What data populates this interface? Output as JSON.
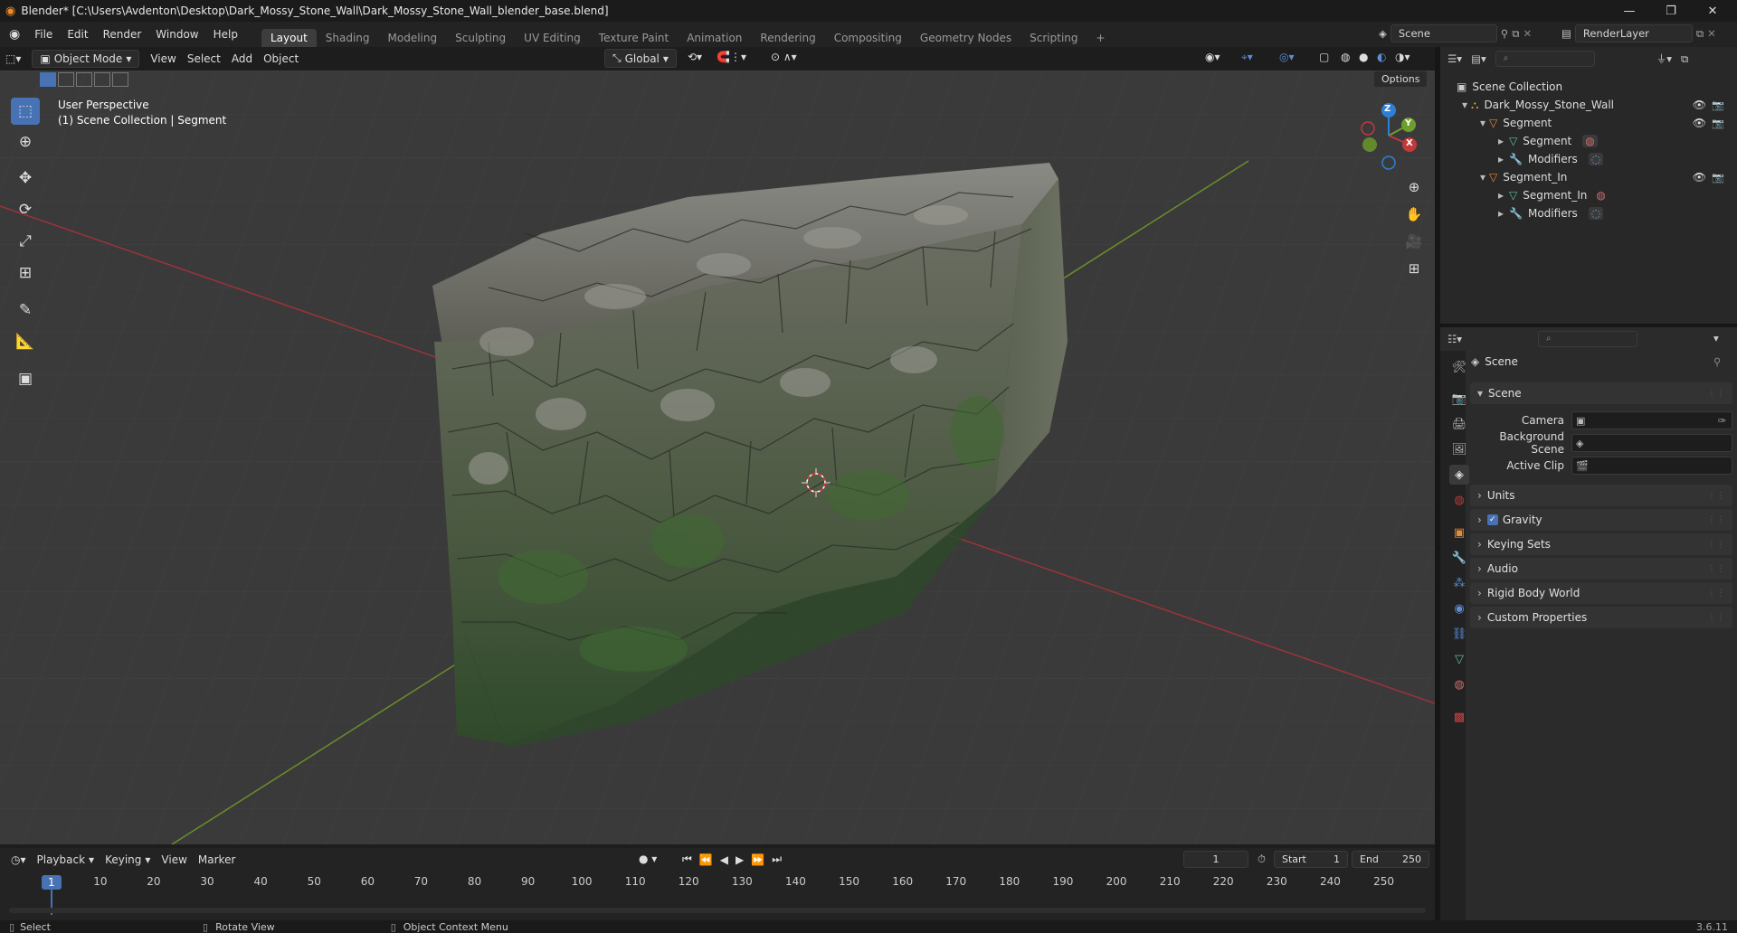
{
  "window": {
    "title": "Blender* [C:\\Users\\Avdenton\\Desktop\\Dark_Mossy_Stone_Wall\\Dark_Mossy_Stone_Wall_blender_base.blend]",
    "minimize": "—",
    "maximize": "❐",
    "close": "✕"
  },
  "menu": {
    "items": [
      "File",
      "Edit",
      "Render",
      "Window",
      "Help"
    ],
    "workspaces": [
      "Layout",
      "Shading",
      "Modeling",
      "Sculpting",
      "UV Editing",
      "Texture Paint",
      "Animation",
      "Rendering",
      "Compositing",
      "Geometry Nodes",
      "Scripting"
    ],
    "active_workspace": "Layout",
    "add_tab": "+",
    "scene": "Scene",
    "render_layer": "RenderLayer"
  },
  "viewport_header": {
    "mode": "Object Mode",
    "menus": [
      "View",
      "Select",
      "Add",
      "Object"
    ],
    "orientation": "Global",
    "options": "Options"
  },
  "viewport": {
    "perspective": "User Perspective",
    "collection_info": "(1) Scene Collection | Segment",
    "gizmo": {
      "z": "Z",
      "y": "Y",
      "x": "X"
    }
  },
  "outliner": {
    "root": "Scene Collection",
    "collection": "Dark_Mossy_Stone_Wall",
    "objects": [
      {
        "name": "Segment",
        "mesh": "Segment",
        "modifiers": "Modifiers"
      },
      {
        "name": "Segment_In",
        "mesh": "Segment_In",
        "modifiers": "Modifiers"
      }
    ]
  },
  "properties": {
    "context": "Scene",
    "panel_title": "Scene",
    "fields": [
      {
        "label": "Camera",
        "value": ""
      },
      {
        "label": "Background Scene",
        "value": ""
      },
      {
        "label": "Active Clip",
        "value": ""
      }
    ],
    "collapsed_panels": [
      "Units",
      "Gravity",
      "Keying Sets",
      "Audio",
      "Rigid Body World",
      "Custom Properties"
    ],
    "gravity_checked": true
  },
  "timeline": {
    "menus": [
      "Playback",
      "Keying",
      "View",
      "Marker"
    ],
    "current_frame": "1",
    "start_label": "Start",
    "start": "1",
    "end_label": "End",
    "end": "250",
    "ticks": [
      "1",
      "10",
      "20",
      "30",
      "40",
      "50",
      "60",
      "70",
      "80",
      "90",
      "100",
      "110",
      "120",
      "130",
      "140",
      "150",
      "160",
      "170",
      "180",
      "190",
      "200",
      "210",
      "220",
      "230",
      "240",
      "250"
    ]
  },
  "status": {
    "select": "Select",
    "rotate": "Rotate View",
    "context_menu": "Object Context Menu",
    "version": "3.6.11"
  },
  "colors": {
    "accent": "#4772b3",
    "x_axis": "#c0393c",
    "y_axis": "#6e9e2b",
    "z_axis": "#2f7fd6",
    "viewport_bg": "#3a3a3a"
  }
}
